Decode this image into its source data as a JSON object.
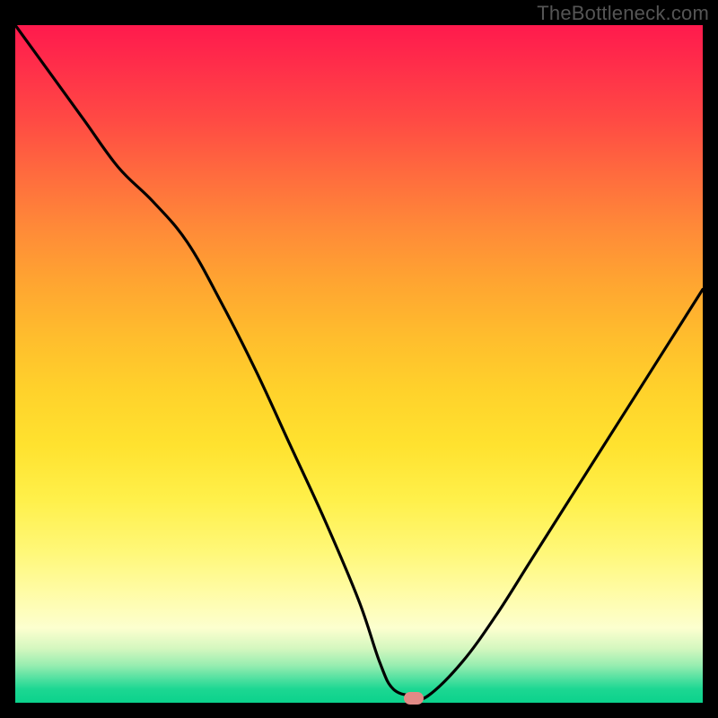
{
  "watermark": "TheBottleneck.com",
  "chart_data": {
    "type": "line",
    "title": "",
    "xlabel": "",
    "ylabel": "",
    "xlim": [
      0,
      100
    ],
    "ylim": [
      0,
      100
    ],
    "series": [
      {
        "name": "curve",
        "x": [
          0,
          5,
          10,
          15,
          20,
          25,
          30,
          35,
          40,
          45,
          50,
          53,
          55,
          58,
          60,
          65,
          70,
          75,
          80,
          85,
          90,
          95,
          100
        ],
        "values": [
          100,
          93,
          86,
          79,
          74,
          68,
          59,
          49,
          38,
          27,
          15,
          6,
          2,
          1,
          1,
          6,
          13,
          21,
          29,
          37,
          45,
          53,
          61
        ]
      }
    ],
    "annotations": [
      {
        "name": "marker",
        "x": 58,
        "y": 0.7
      }
    ],
    "background_gradient": {
      "direction": "vertical",
      "stops": [
        {
          "pos": 0,
          "color": "#ff1a4d"
        },
        {
          "pos": 30,
          "color": "#ff8a38"
        },
        {
          "pos": 60,
          "color": "#ffe22f"
        },
        {
          "pos": 88,
          "color": "#fcffcf"
        },
        {
          "pos": 95,
          "color": "#4fe0a0"
        },
        {
          "pos": 100,
          "color": "#0bd28c"
        }
      ]
    }
  }
}
